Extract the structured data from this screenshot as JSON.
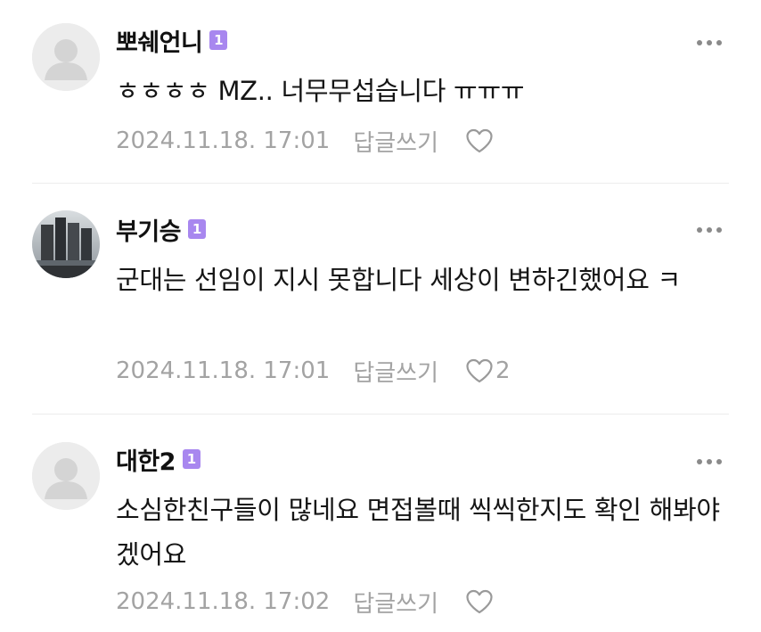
{
  "comments": [
    {
      "author": "뽀쉐언니",
      "level": "1",
      "text": "ㅎㅎㅎㅎ MZ.. 너무무섭습니다 ㅠㅠㅠ",
      "timestamp": "2024.11.18. 17:01",
      "reply_label": "답글쓰기",
      "like_count": "",
      "avatar": "default-avatar-icon"
    },
    {
      "author": "부기승",
      "level": "1",
      "text": "군대는 선임이 지시 못합니다 세상이 변하긴했어요 ㅋ",
      "timestamp": "2024.11.18. 17:01",
      "reply_label": "답글쓰기",
      "like_count": "2",
      "avatar": "photo-avatar"
    },
    {
      "author": "대한2",
      "level": "1",
      "text": "소심한친구들이 많네요 면접볼때 씩씩한지도 확인 해봐야겠어요",
      "timestamp": "2024.11.18. 17:02",
      "reply_label": "답글쓰기",
      "like_count": "",
      "avatar": "default-avatar-icon"
    }
  ],
  "icons": {
    "more": "more-dots-icon",
    "like": "heart-outline-icon"
  },
  "colors": {
    "level_badge": "#a887ef",
    "meta_text": "#a3a3a3",
    "divider": "#ececec"
  }
}
